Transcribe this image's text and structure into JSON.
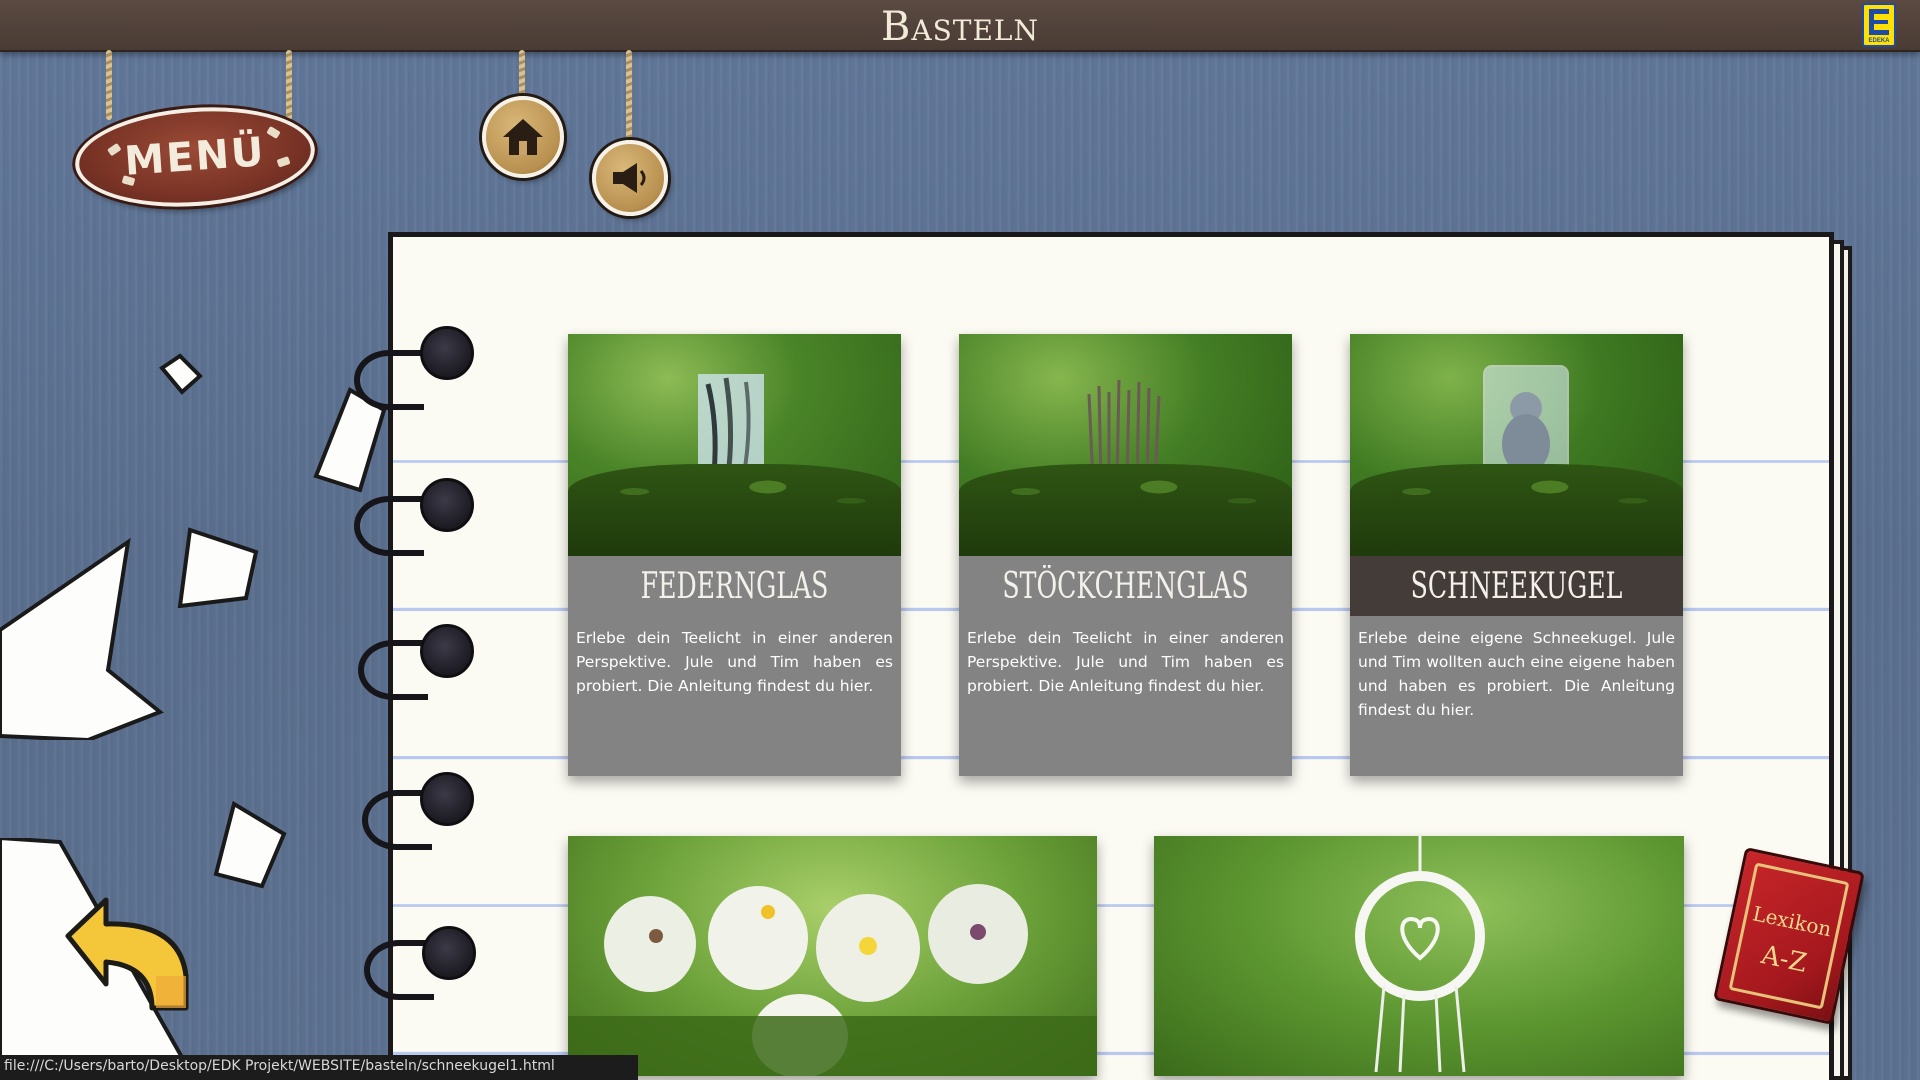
{
  "header": {
    "title": "Basteln",
    "brand_logo_text": "EDEKA"
  },
  "nav": {
    "menu_label": "MENÜ",
    "home_icon": "home-icon",
    "sound_icon": "speaker-icon",
    "back_icon": "back-arrow-icon",
    "lexikon_label_1": "Lexikon",
    "lexikon_label_2": "A-Z"
  },
  "cards": [
    {
      "title": "Federnglas",
      "description": "Erlebe dein Teelicht in einer anderen Perspektive. Jule und Tim haben es probiert. Die Anleitung findest du hier."
    },
    {
      "title": "Stöckchenglas",
      "description": "Erlebe dein Teelicht in einer anderen Perspektive. Jule und Tim haben es probiert. Die Anleitung findest du hier."
    },
    {
      "title": "Schneekugel",
      "description": "Erlebe deine eigene Schneekugel. Jule und Tim wollten auch eine eigene haben und haben es probiert. Die Anleitung findest du hier."
    }
  ],
  "status_bar": {
    "url": "file:///C:/Users/barto/Desktop/EDK Projekt/WEBSITE/basteln/schneekugel1.html"
  },
  "colors": {
    "topbar": "#4f3f38",
    "card_bg": "#838383",
    "card_active_caption": "#443c38",
    "background_wood": "#5f7492",
    "notebook_lines": "#b9c8ef"
  }
}
